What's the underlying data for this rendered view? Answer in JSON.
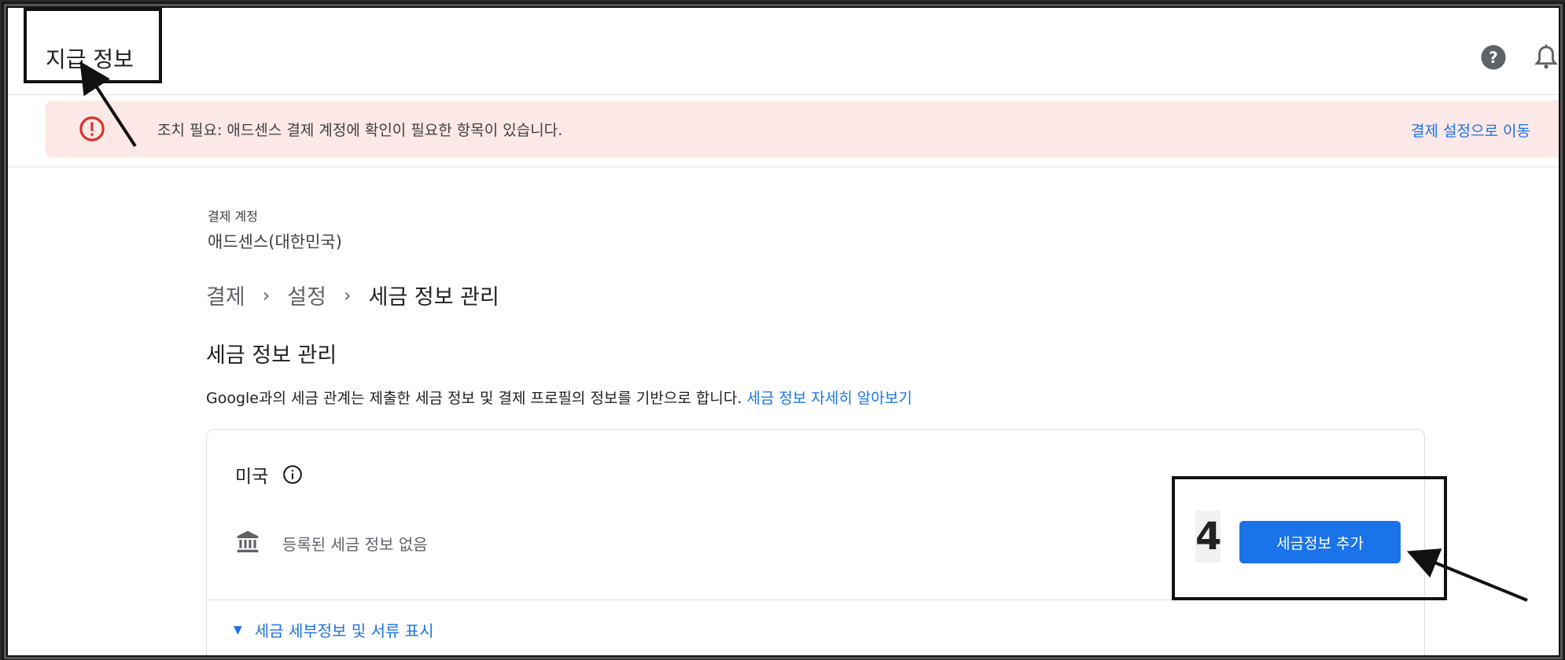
{
  "header": {
    "title": "지급 정보",
    "help_icon": "help-circle-icon",
    "bell_icon": "bell-icon"
  },
  "alert": {
    "icon": "error-icon",
    "text": "조치 필요: 애드센스 결제 계정에 확인이 필요한 항목이 있습니다.",
    "link": "결제 설정으로 이동",
    "color": "#fce8e6",
    "icon_color": "#d93025"
  },
  "account": {
    "label": "결제 계정",
    "value": "애드센스(대한민국)"
  },
  "breadcrumb": {
    "items": [
      "결제",
      "설정",
      "세금 정보 관리"
    ],
    "separator": "›"
  },
  "section": {
    "title": "세금 정보 관리",
    "description": "Google과의 세금 관계는 제출한 세금 정보 및 결제 프로필의 정보를 기반으로 합니다.",
    "learn_more": "세금 정보 자세히 알아보기"
  },
  "card": {
    "country": "미국",
    "no_tax_info": "등록된 세금 정보 없음",
    "add_button": "세금정보 추가",
    "expand_label": "세금 세부정보 및 서류 표시",
    "accent": "#1a73e8"
  },
  "annotation": {
    "step_number": "4"
  }
}
